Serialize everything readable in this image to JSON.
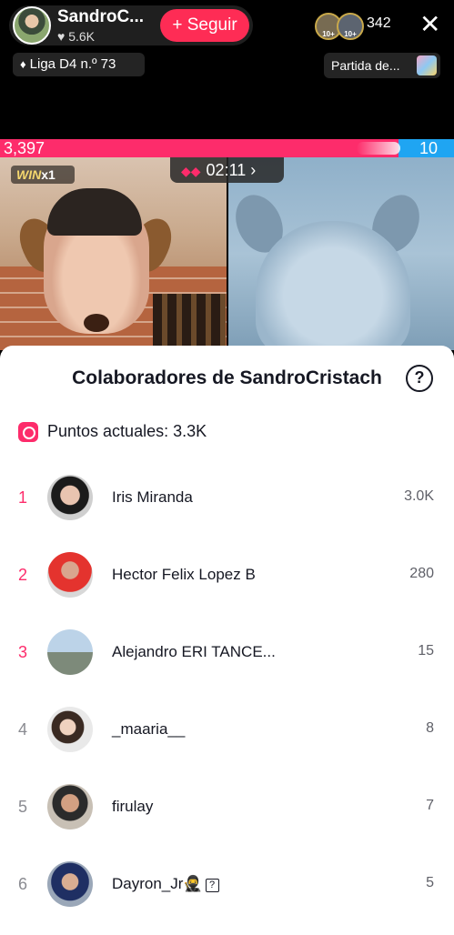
{
  "header": {
    "host_name": "SandroC...",
    "host_likes": "♥ 5.6K",
    "follow_label": "+ Seguir",
    "viewer_badge_1": "10+",
    "viewer_badge_2": "10+",
    "viewer_count": "342",
    "close_icon": "close-icon",
    "league_label": "Liga D4 n.º 73",
    "match_label": "Partida de..."
  },
  "battle": {
    "left_score": "3,397",
    "right_score": "10",
    "left_share": 0.877,
    "win_prefix": "WIN",
    "win_count": "x1",
    "timer": "02:11",
    "timer_chevron": "›",
    "colors": {
      "left": "#fd2c6b",
      "right": "#1fa5f2"
    }
  },
  "sheet": {
    "title": "Colaboradores de SandroCristach",
    "help_icon_label": "?",
    "points_label": "Puntos actuales: 3.3K"
  },
  "contributors": [
    {
      "rank": "1",
      "name": "Iris Miranda",
      "score": "3.0K"
    },
    {
      "rank": "2",
      "name": "Hector Felix Lopez B",
      "score": "280"
    },
    {
      "rank": "3",
      "name": "Alejandro ERI TANCE...",
      "score": "15"
    },
    {
      "rank": "4",
      "name": "_maaria__",
      "score": "8"
    },
    {
      "rank": "5",
      "name": "firulay",
      "score": "7"
    },
    {
      "rank": "6",
      "name": "Dayron_Jr🥷",
      "badge": "?",
      "score": "5"
    }
  ]
}
